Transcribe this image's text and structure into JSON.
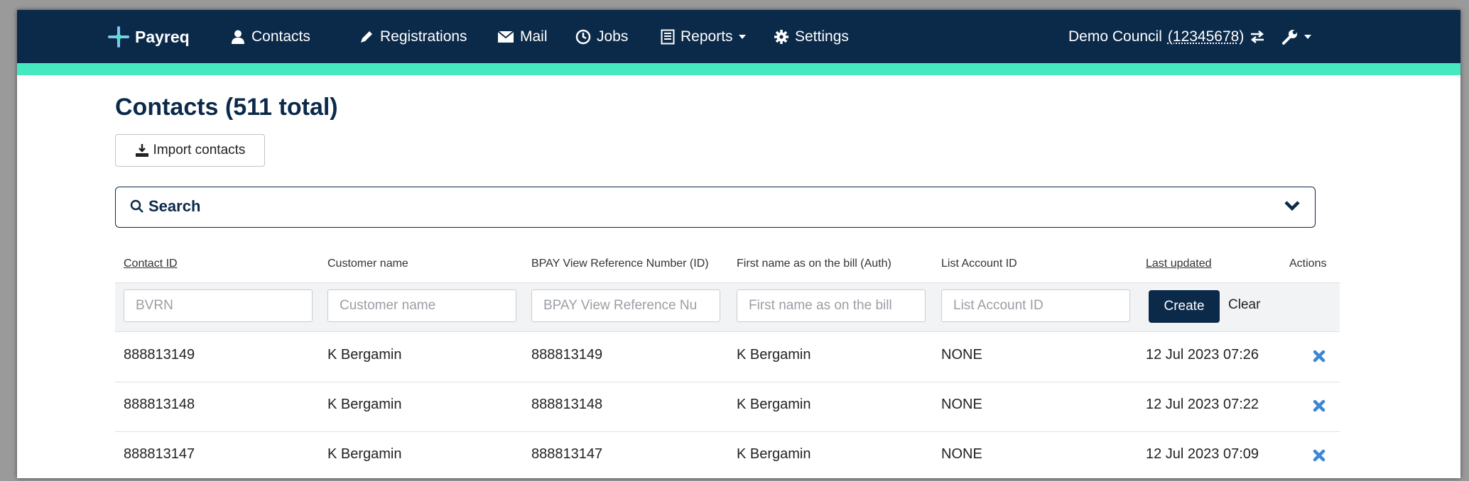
{
  "nav": {
    "brand": "Payreq",
    "items": [
      {
        "label": "Contacts",
        "icon": "user-icon"
      },
      {
        "label": "Registrations",
        "icon": "pencil-icon"
      },
      {
        "label": "Mail",
        "icon": "envelope-icon"
      },
      {
        "label": "Jobs",
        "icon": "clock-icon"
      },
      {
        "label": "Reports",
        "icon": "list-icon"
      },
      {
        "label": "Settings",
        "icon": "gear-icon"
      }
    ],
    "account_name": "Demo Council",
    "account_id": "(12345678)",
    "colors": {
      "navbar": "#0b2a4a",
      "accent": "#46e8c0"
    }
  },
  "page": {
    "title": "Contacts (511 total)",
    "import_label": "Import contacts",
    "search_label": "Search"
  },
  "table": {
    "headers": [
      "Contact ID",
      "Customer name",
      "BPAY View Reference Number (ID)",
      "First name as on the bill (Auth)",
      "List Account ID",
      "Last updated",
      "Actions"
    ],
    "filters": {
      "placeholders": [
        "BVRN",
        "Customer name",
        "BPAY View Reference Nu",
        "First name as on the bill",
        "List Account ID"
      ],
      "create_label": "Create",
      "clear_label": "Clear"
    },
    "rows": [
      [
        "888813149",
        "K Bergamin",
        "888813149",
        "K Bergamin",
        "NONE",
        "12 Jul 2023 07:26"
      ],
      [
        "888813148",
        "K Bergamin",
        "888813148",
        "K Bergamin",
        "NONE",
        "12 Jul 2023 07:22"
      ],
      [
        "888813147",
        "K Bergamin",
        "888813147",
        "K Bergamin",
        "NONE",
        "12 Jul 2023 07:09"
      ]
    ],
    "delete_icon_color": "#3d86d6"
  }
}
